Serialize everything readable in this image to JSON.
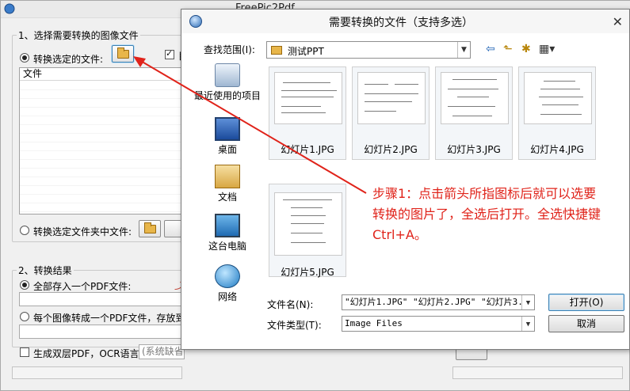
{
  "main_window": {
    "title": "FreePic2Pdf",
    "group1_title": "1、选择需要转换的图像文件",
    "radio_selected_files": "转换选定的文件:",
    "file_list_header": "文件",
    "radio_folder_files": "转换选定文件夹中文件:",
    "group2_title": "2、转换结果",
    "radio_single_pdf": "全部存入一个PDF文件:",
    "radio_each_pdf": "每个图像转成一个PDF文件，存放到",
    "checkbox_ocr": "生成双层PDF，OCR语言:",
    "ocr_language": "(系统缺省"
  },
  "dialog": {
    "title": "需要转换的文件（支持多选）",
    "look_in_label": "查找范围(I):",
    "look_in_value": "测试PPT",
    "places": [
      {
        "label": "最近使用的项目",
        "icon": "recent-items-icon"
      },
      {
        "label": "桌面",
        "icon": "desktop-icon"
      },
      {
        "label": "文档",
        "icon": "documents-icon"
      },
      {
        "label": "这台电脑",
        "icon": "this-pc-icon"
      },
      {
        "label": "网络",
        "icon": "network-icon"
      }
    ],
    "files": [
      {
        "name": "幻灯片1.JPG"
      },
      {
        "name": "幻灯片2.JPG"
      },
      {
        "name": "幻灯片3.JPG"
      },
      {
        "name": "幻灯片4.JPG"
      },
      {
        "name": "幻灯片5.JPG"
      }
    ],
    "filename_label": "文件名(N):",
    "filename_value": "\"幻灯片1.JPG\" \"幻灯片2.JPG\" \"幻灯片3.",
    "filetype_label": "文件类型(T):",
    "filetype_value": "Image Files",
    "open_button": "打开(O)",
    "cancel_button": "取消"
  },
  "annotation": {
    "text": "步骤1：点击箭头所指图标后就可以选要转换的图片了，全选后打开。全选快捷键Ctrl+A。",
    "color": "#e0231a"
  }
}
